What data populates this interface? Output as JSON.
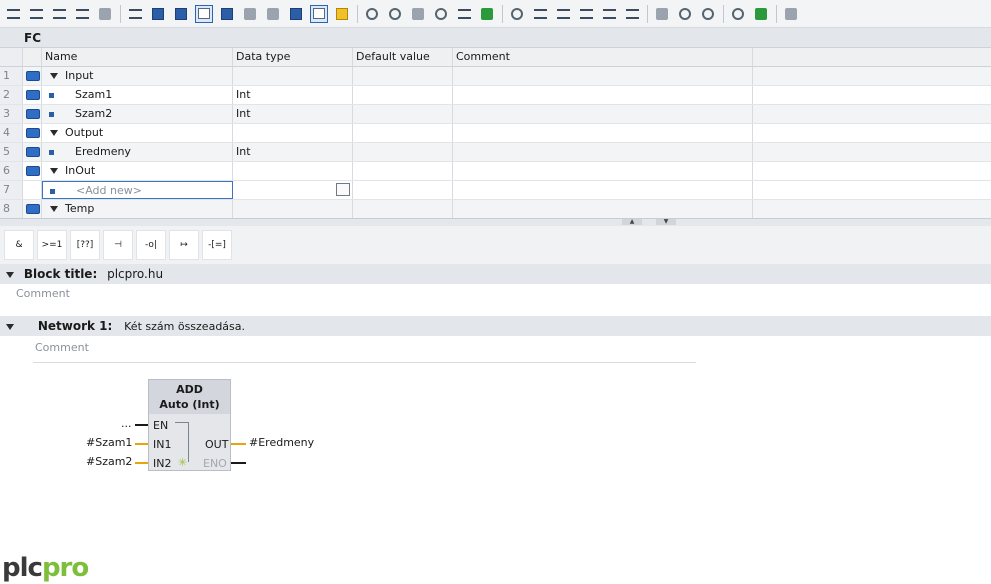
{
  "toolbar": {
    "icons": [
      "insert-network-icon",
      "delete-network-icon",
      "insert-row-icon",
      "add-row-icon",
      "open-close-icon",
      "network-view-icon",
      "abs-absolute-icon",
      "symbolic-icon",
      "comments-icon",
      "insert-input-icon",
      "insert-input2-icon",
      "insert-output-icon",
      "navigation-icon",
      "favorites-icon",
      "monitor-icon",
      "reset-icon",
      "display-icon",
      "force-icon",
      "download-icon",
      "goto-icon",
      "next-icon",
      "prev-icon",
      "align-icon",
      "sort-icon",
      "split-icon",
      "bookmark-icon",
      "prev-bookmark-icon",
      "next-bookmark-icon",
      "search-icon",
      "glasses-icon",
      "database-icon"
    ]
  },
  "interface": {
    "title": "FC",
    "columns": [
      "Name",
      "Data type",
      "Default value",
      "Comment"
    ],
    "rows": [
      {
        "num": "1",
        "name": "Input",
        "type": "",
        "kind": "section"
      },
      {
        "num": "2",
        "name": "Szam1",
        "type": "Int",
        "kind": "var"
      },
      {
        "num": "3",
        "name": "Szam2",
        "type": "Int",
        "kind": "var"
      },
      {
        "num": "4",
        "name": "Output",
        "type": "",
        "kind": "section"
      },
      {
        "num": "5",
        "name": "Eredmeny",
        "type": "Int",
        "kind": "var"
      },
      {
        "num": "6",
        "name": "InOut",
        "type": "",
        "kind": "section"
      },
      {
        "num": "7",
        "name": "<Add new>",
        "type": "",
        "kind": "add"
      },
      {
        "num": "8",
        "name": "Temp",
        "type": "",
        "kind": "section"
      }
    ]
  },
  "palette": {
    "items": [
      "&",
      ">=1",
      "[??]",
      "⊣",
      "-o|",
      "↦",
      "-[=]"
    ]
  },
  "block": {
    "title_label": "Block title:",
    "title_value": "plcpro.hu",
    "comment_placeholder": "Comment"
  },
  "network": {
    "label": "Network 1:",
    "title": "Két szám összeadása.",
    "comment_placeholder": "Comment"
  },
  "lad": {
    "box_name": "ADD",
    "box_type": "Auto (Int)",
    "pins": {
      "en": "EN",
      "in1": "IN1",
      "in2": "IN2",
      "out": "OUT",
      "eno": "ENO"
    },
    "en_operand": "...",
    "in1_operand": "#Szam1",
    "in2_operand": "#Szam2",
    "out_operand": "#Eredmeny"
  },
  "logo": {
    "part1": "plc",
    "part2": "pro"
  }
}
